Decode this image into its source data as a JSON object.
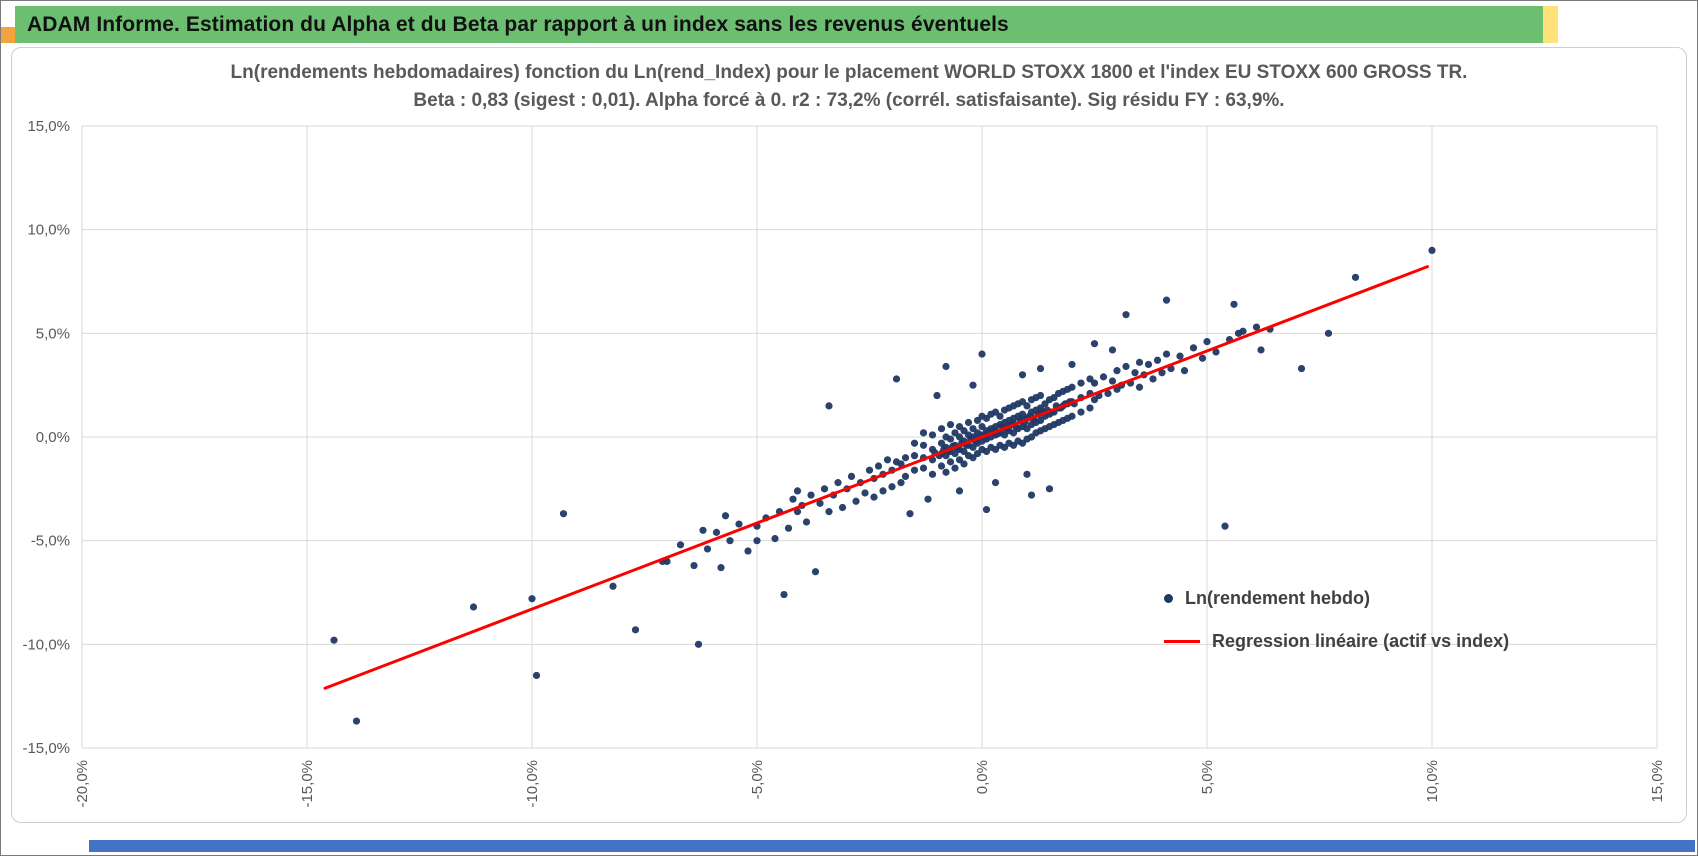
{
  "header": {
    "title": "ADAM Informe. Estimation du Alpha et du Beta par rapport à un index sans les revenus éventuels"
  },
  "colors": {
    "accent_green": "#6CBE71",
    "accent_orange": "#F2A33C",
    "accent_yellow": "#FFE27A",
    "accent_blue": "#4472C4",
    "grid": "#D9D9D9",
    "scatter_dot": "#1F3864",
    "regression_line": "#FF0000",
    "title_gray": "#595959"
  },
  "stats": {
    "beta": "0,83",
    "sigest": "0,01",
    "alpha": "forcé à 0",
    "r2": "73,2%",
    "sig_residu_fy": "63,9%"
  },
  "chart_data": {
    "type": "scatter",
    "title": "Ln(rendements hebdomadaires) fonction du Ln(rend_Index) pour le placement WORLD STOXX 1800 et l'index EU STOXX 600 GROSS TR.",
    "subtitle": "Beta : 0,83 (sigest : 0,01).  Alpha forcé à 0. r2 : 73,2% (corrél. satisfaisante). Sig résidu FY : 63,9%.",
    "xlabel": "",
    "ylabel": "",
    "xlim": [
      -20,
      15
    ],
    "ylim": [
      -15,
      15
    ],
    "grid": true,
    "grid_color": "#D9D9D9",
    "x_ticks": [
      "-20,0%",
      "-15,0%",
      "-10,0%",
      "-5,0%",
      "0,0%",
      "5,0%",
      "10,0%",
      "15,0%"
    ],
    "x_tick_values": [
      -20,
      -15,
      -10,
      -5,
      0,
      5,
      10,
      15
    ],
    "y_ticks": [
      "15,0%",
      "10,0%",
      "5,0%",
      "0,0%",
      "-5,0%",
      "-10,0%",
      "-15,0%"
    ],
    "y_tick_values": [
      15,
      10,
      5,
      0,
      -5,
      -10,
      -15
    ],
    "legend": {
      "position": "inside-right",
      "entries": [
        {
          "label": "Ln(rendement hebdo)",
          "marker": "dot",
          "color": "#1F3864"
        },
        {
          "label": "Regression linéaire (actif vs index)",
          "marker": "line",
          "color": "#FF0000"
        }
      ]
    },
    "regression": {
      "slope": 0.83,
      "intercept": 0,
      "x_start": -14.6,
      "x_end": 9.9,
      "color": "#FF0000"
    },
    "series": [
      {
        "name": "Ln(rendement hebdo)",
        "color": "#1F3864",
        "points": [
          [
            -1.5,
            -1.6
          ],
          [
            -1.5,
            -0.9
          ],
          [
            -1.5,
            -0.3
          ],
          [
            -1.3,
            -1.5
          ],
          [
            -1.3,
            -1.0
          ],
          [
            -1.3,
            -0.4
          ],
          [
            -1.3,
            0.2
          ],
          [
            -1.1,
            -1.8
          ],
          [
            -1.1,
            -1.1
          ],
          [
            -1.1,
            -0.6
          ],
          [
            -1.1,
            0.1
          ],
          [
            -0.9,
            -1.4
          ],
          [
            -0.9,
            -0.8
          ],
          [
            -0.9,
            -0.3
          ],
          [
            -0.9,
            0.4
          ],
          [
            -0.8,
            -1.7
          ],
          [
            -0.8,
            -0.9
          ],
          [
            -0.8,
            -0.5
          ],
          [
            -0.8,
            0.0
          ],
          [
            -0.7,
            -1.2
          ],
          [
            -0.7,
            -0.7
          ],
          [
            -0.7,
            -0.1
          ],
          [
            -0.7,
            0.6
          ],
          [
            -0.6,
            -1.5
          ],
          [
            -0.6,
            -0.8
          ],
          [
            -0.6,
            -0.4
          ],
          [
            -0.6,
            0.2
          ],
          [
            -0.5,
            -1.1
          ],
          [
            -0.5,
            -0.6
          ],
          [
            -0.5,
            0.0
          ],
          [
            -0.5,
            0.5
          ],
          [
            -0.4,
            -1.3
          ],
          [
            -0.4,
            -0.7
          ],
          [
            -0.4,
            -0.2
          ],
          [
            -0.4,
            0.3
          ],
          [
            -0.3,
            -0.9
          ],
          [
            -0.3,
            -0.4
          ],
          [
            -0.3,
            0.1
          ],
          [
            -0.3,
            0.7
          ],
          [
            -0.2,
            -1.0
          ],
          [
            -0.2,
            -0.5
          ],
          [
            -0.2,
            0.0
          ],
          [
            -0.2,
            0.4
          ],
          [
            -0.1,
            -0.8
          ],
          [
            -0.1,
            -0.3
          ],
          [
            -0.1,
            0.2
          ],
          [
            -0.1,
            0.8
          ],
          [
            0.0,
            -0.6
          ],
          [
            0.0,
            -0.2
          ],
          [
            0.0,
            0.1
          ],
          [
            0.0,
            0.5
          ],
          [
            0.0,
            1.0
          ],
          [
            0.1,
            -0.7
          ],
          [
            0.1,
            -0.1
          ],
          [
            0.1,
            0.3
          ],
          [
            0.1,
            0.9
          ],
          [
            0.2,
            -0.5
          ],
          [
            0.2,
            0.0
          ],
          [
            0.2,
            0.4
          ],
          [
            0.2,
            1.1
          ],
          [
            0.3,
            -0.6
          ],
          [
            0.3,
            0.1
          ],
          [
            0.3,
            0.5
          ],
          [
            0.3,
            1.2
          ],
          [
            0.4,
            -0.4
          ],
          [
            0.4,
            0.2
          ],
          [
            0.4,
            0.6
          ],
          [
            0.4,
            1.0
          ],
          [
            0.5,
            -0.5
          ],
          [
            0.5,
            0.1
          ],
          [
            0.5,
            0.7
          ],
          [
            0.5,
            1.3
          ],
          [
            0.6,
            -0.3
          ],
          [
            0.6,
            0.3
          ],
          [
            0.6,
            0.8
          ],
          [
            0.6,
            1.4
          ],
          [
            0.7,
            -0.4
          ],
          [
            0.7,
            0.2
          ],
          [
            0.7,
            0.9
          ],
          [
            0.7,
            1.5
          ],
          [
            0.8,
            -0.2
          ],
          [
            0.8,
            0.4
          ],
          [
            0.8,
            1.0
          ],
          [
            0.8,
            1.6
          ],
          [
            0.9,
            -0.3
          ],
          [
            0.9,
            0.5
          ],
          [
            0.9,
            1.1
          ],
          [
            0.9,
            1.7
          ],
          [
            1.0,
            -0.1
          ],
          [
            1.0,
            0.4
          ],
          [
            1.0,
            0.9
          ],
          [
            1.0,
            1.5
          ],
          [
            1.1,
            0.0
          ],
          [
            1.1,
            0.6
          ],
          [
            1.1,
            1.2
          ],
          [
            1.1,
            1.8
          ],
          [
            1.2,
            0.2
          ],
          [
            1.2,
            0.7
          ],
          [
            1.2,
            1.3
          ],
          [
            1.2,
            1.9
          ],
          [
            1.3,
            0.3
          ],
          [
            1.3,
            0.8
          ],
          [
            1.3,
            1.4
          ],
          [
            1.3,
            2.0
          ],
          [
            1.4,
            0.4
          ],
          [
            1.4,
            1.0
          ],
          [
            1.4,
            1.6
          ],
          [
            1.5,
            0.5
          ],
          [
            1.5,
            1.1
          ],
          [
            1.5,
            1.8
          ],
          [
            1.6,
            0.6
          ],
          [
            1.6,
            1.2
          ],
          [
            1.6,
            1.9
          ],
          [
            1.7,
            0.7
          ],
          [
            1.7,
            1.4
          ],
          [
            1.7,
            2.1
          ],
          [
            1.8,
            0.8
          ],
          [
            1.8,
            1.5
          ],
          [
            1.8,
            2.2
          ],
          [
            1.9,
            0.9
          ],
          [
            1.9,
            1.6
          ],
          [
            1.9,
            2.3
          ],
          [
            2.0,
            1.0
          ],
          [
            2.0,
            1.7
          ],
          [
            2.0,
            2.4
          ],
          [
            2.2,
            1.2
          ],
          [
            2.2,
            1.9
          ],
          [
            2.2,
            2.6
          ],
          [
            2.4,
            1.4
          ],
          [
            2.4,
            2.1
          ],
          [
            2.4,
            2.8
          ],
          [
            0.15,
            0.2
          ],
          [
            0.25,
            0.3
          ],
          [
            0.35,
            0.15
          ],
          [
            0.45,
            0.5
          ],
          [
            0.55,
            0.35
          ],
          [
            0.65,
            0.6
          ],
          [
            0.75,
            0.5
          ],
          [
            0.85,
            0.8
          ],
          [
            0.95,
            0.7
          ],
          [
            1.05,
            1.0
          ],
          [
            1.15,
            0.85
          ],
          [
            1.25,
            1.1
          ],
          [
            1.35,
            1.2
          ],
          [
            1.45,
            1.3
          ],
          [
            1.55,
            1.2
          ],
          [
            1.65,
            1.5
          ],
          [
            1.75,
            1.4
          ],
          [
            1.85,
            1.6
          ],
          [
            1.95,
            1.7
          ],
          [
            2.05,
            1.6
          ],
          [
            -0.15,
            -0.2
          ],
          [
            -0.25,
            -0.1
          ],
          [
            -0.35,
            -0.4
          ],
          [
            -0.45,
            -0.3
          ],
          [
            -0.55,
            -0.55
          ],
          [
            -0.65,
            -0.45
          ],
          [
            -0.75,
            -0.7
          ],
          [
            -0.85,
            -0.6
          ],
          [
            -0.95,
            -0.9
          ],
          [
            -1.05,
            -0.75
          ],
          [
            0.05,
            0.0
          ],
          [
            0.5,
            0.45
          ],
          [
            0.7,
            0.65
          ],
          [
            0.9,
            0.85
          ],
          [
            1.1,
            0.95
          ],
          [
            1.3,
            1.15
          ],
          [
            0.3,
            0.3
          ],
          [
            0.1,
            0.15
          ],
          [
            -0.1,
            -0.05
          ],
          [
            0.6,
            0.55
          ],
          [
            -1.7,
            -1.9
          ],
          [
            -1.7,
            -1.0
          ],
          [
            -1.8,
            -2.2
          ],
          [
            -1.8,
            -1.3
          ],
          [
            -1.9,
            -1.2
          ],
          [
            -2.0,
            -2.4
          ],
          [
            -2.0,
            -1.6
          ],
          [
            -2.1,
            -1.1
          ],
          [
            -2.2,
            -2.6
          ],
          [
            -2.2,
            -1.8
          ],
          [
            -2.3,
            -1.4
          ],
          [
            -2.4,
            -2.9
          ],
          [
            -2.4,
            -2.0
          ],
          [
            -2.5,
            -1.6
          ],
          [
            -2.6,
            -2.7
          ],
          [
            -2.7,
            -2.2
          ],
          [
            -2.8,
            -3.1
          ],
          [
            -2.9,
            -1.9
          ],
          [
            -3.0,
            -2.5
          ],
          [
            -3.1,
            -3.4
          ],
          [
            -3.2,
            -2.2
          ],
          [
            -3.3,
            -2.8
          ],
          [
            -3.4,
            -3.6
          ],
          [
            -3.5,
            -2.5
          ],
          [
            -3.6,
            -3.2
          ],
          [
            -3.8,
            -2.8
          ],
          [
            -3.9,
            -4.1
          ],
          [
            -4.0,
            -3.3
          ],
          [
            -4.2,
            -3.0
          ],
          [
            -4.3,
            -4.4
          ],
          [
            -4.5,
            -3.6
          ],
          [
            -4.6,
            -4.9
          ],
          [
            -4.8,
            -3.9
          ],
          [
            -5.0,
            -4.3
          ],
          [
            -5.2,
            -5.5
          ],
          [
            -5.4,
            -4.2
          ],
          [
            -5.6,
            -5.0
          ],
          [
            -5.9,
            -4.6
          ],
          [
            -6.1,
            -5.4
          ],
          [
            -6.4,
            -6.2
          ],
          [
            -6.7,
            -5.2
          ],
          [
            -7.0,
            -6.0
          ],
          [
            -6.2,
            -4.5
          ],
          [
            -5.8,
            -6.3
          ],
          [
            -4.1,
            -2.6
          ],
          [
            2.5,
            1.8
          ],
          [
            2.5,
            2.6
          ],
          [
            2.6,
            2.0
          ],
          [
            2.7,
            2.9
          ],
          [
            2.8,
            2.1
          ],
          [
            2.9,
            2.7
          ],
          [
            3.0,
            2.3
          ],
          [
            3.0,
            3.2
          ],
          [
            3.1,
            2.5
          ],
          [
            3.2,
            3.4
          ],
          [
            3.3,
            2.6
          ],
          [
            3.4,
            3.1
          ],
          [
            3.5,
            2.4
          ],
          [
            3.5,
            3.6
          ],
          [
            3.6,
            3.0
          ],
          [
            3.7,
            3.5
          ],
          [
            3.8,
            2.8
          ],
          [
            3.9,
            3.7
          ],
          [
            4.0,
            3.1
          ],
          [
            4.1,
            4.0
          ],
          [
            4.2,
            3.3
          ],
          [
            4.4,
            3.9
          ],
          [
            4.5,
            3.2
          ],
          [
            4.7,
            4.3
          ],
          [
            4.9,
            3.8
          ],
          [
            5.0,
            4.6
          ],
          [
            5.2,
            4.1
          ],
          [
            5.5,
            4.7
          ],
          [
            5.8,
            5.1
          ],
          [
            6.1,
            5.3
          ],
          [
            6.4,
            5.2
          ],
          [
            2.5,
            4.5
          ],
          [
            3.2,
            5.9
          ],
          [
            4.1,
            6.6
          ],
          [
            2.9,
            4.2
          ],
          [
            0.9,
            3.0
          ],
          [
            1.3,
            3.3
          ],
          [
            -0.2,
            2.5
          ],
          [
            -1.0,
            2.0
          ],
          [
            2.0,
            3.5
          ],
          [
            -0.8,
            3.4
          ],
          [
            -1.9,
            2.8
          ],
          [
            0.0,
            4.0
          ],
          [
            -3.4,
            1.5
          ],
          [
            -0.5,
            -2.6
          ],
          [
            0.3,
            -2.2
          ],
          [
            1.0,
            -1.8
          ],
          [
            -1.2,
            -3.0
          ],
          [
            -1.6,
            -3.7
          ],
          [
            0.1,
            -3.5
          ],
          [
            1.1,
            -2.8
          ],
          [
            -4.1,
            -3.6
          ],
          [
            5.4,
            -4.3
          ],
          [
            1.5,
            -2.5
          ],
          [
            -14.4,
            -9.8
          ],
          [
            -13.9,
            -13.7
          ],
          [
            -11.3,
            -8.2
          ],
          [
            -10.0,
            -7.8
          ],
          [
            -9.9,
            -11.5
          ],
          [
            -9.3,
            -3.7
          ],
          [
            -8.2,
            -7.2
          ],
          [
            -7.7,
            -9.3
          ],
          [
            -7.1,
            -6.0
          ],
          [
            -6.3,
            -10.0
          ],
          [
            -5.7,
            -3.8
          ],
          [
            -5.0,
            -5.0
          ],
          [
            -4.4,
            -7.6
          ],
          [
            -3.7,
            -6.5
          ],
          [
            10.0,
            9.0
          ],
          [
            8.3,
            7.7
          ],
          [
            7.1,
            3.3
          ],
          [
            7.7,
            5.0
          ],
          [
            5.6,
            6.4
          ],
          [
            5.7,
            5.0
          ],
          [
            6.2,
            4.2
          ]
        ]
      }
    ]
  }
}
